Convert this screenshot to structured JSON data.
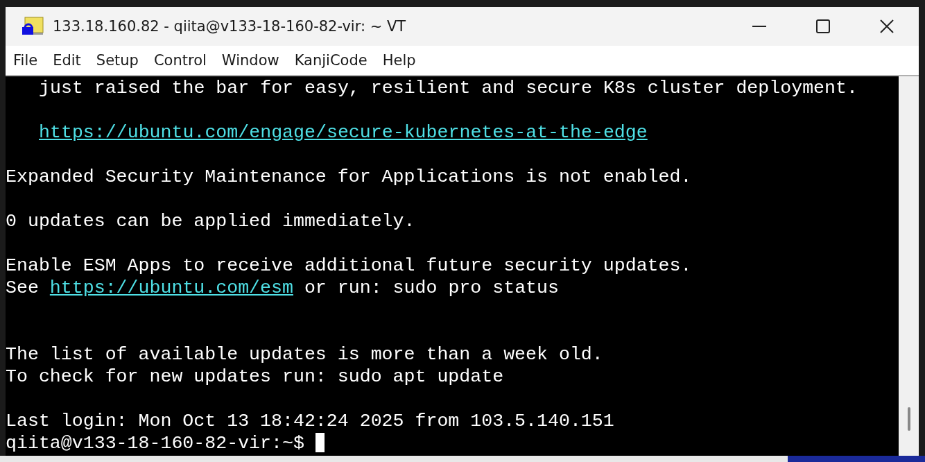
{
  "window": {
    "title": "133.18.160.82 - qiita@v133-18-160-82-vir: ~ VT"
  },
  "menu": [
    "File",
    "Edit",
    "Setup",
    "Control",
    "Window",
    "KanjiCode",
    "Help"
  ],
  "terminal": {
    "lines": [
      {
        "kind": "indented",
        "segments": [
          {
            "kind": "text",
            "text": "just raised the bar for easy, resilient and secure K8s cluster deployment."
          }
        ]
      },
      {
        "kind": "blank"
      },
      {
        "kind": "indented",
        "segments": [
          {
            "kind": "link",
            "text": "https://ubuntu.com/engage/secure-kubernetes-at-the-edge"
          }
        ]
      },
      {
        "kind": "blank"
      },
      {
        "kind": "text",
        "segments": [
          {
            "kind": "text",
            "text": "Expanded Security Maintenance for Applications is not enabled."
          }
        ]
      },
      {
        "kind": "blank"
      },
      {
        "kind": "text",
        "segments": [
          {
            "kind": "text",
            "text": "0 updates can be applied immediately."
          }
        ]
      },
      {
        "kind": "blank"
      },
      {
        "kind": "text",
        "segments": [
          {
            "kind": "text",
            "text": "Enable ESM Apps to receive additional future security updates."
          }
        ]
      },
      {
        "kind": "text",
        "segments": [
          {
            "kind": "text",
            "text": "See "
          },
          {
            "kind": "link",
            "text": "https://ubuntu.com/esm"
          },
          {
            "kind": "text",
            "text": " or run: sudo pro status"
          }
        ]
      },
      {
        "kind": "blank"
      },
      {
        "kind": "blank"
      },
      {
        "kind": "text",
        "segments": [
          {
            "kind": "text",
            "text": "The list of available updates is more than a week old."
          }
        ]
      },
      {
        "kind": "text",
        "segments": [
          {
            "kind": "text",
            "text": "To check for new updates run: sudo apt update"
          }
        ]
      },
      {
        "kind": "blank"
      },
      {
        "kind": "text",
        "segments": [
          {
            "kind": "text",
            "text": "Last login: Mon Oct 13 18:42:24 2025 from 103.5.140.151"
          }
        ]
      },
      {
        "kind": "prompt",
        "cursor": true,
        "segments": [
          {
            "kind": "text",
            "text": "qiita@v133-18-160-82-vir:~$ "
          }
        ]
      }
    ]
  }
}
